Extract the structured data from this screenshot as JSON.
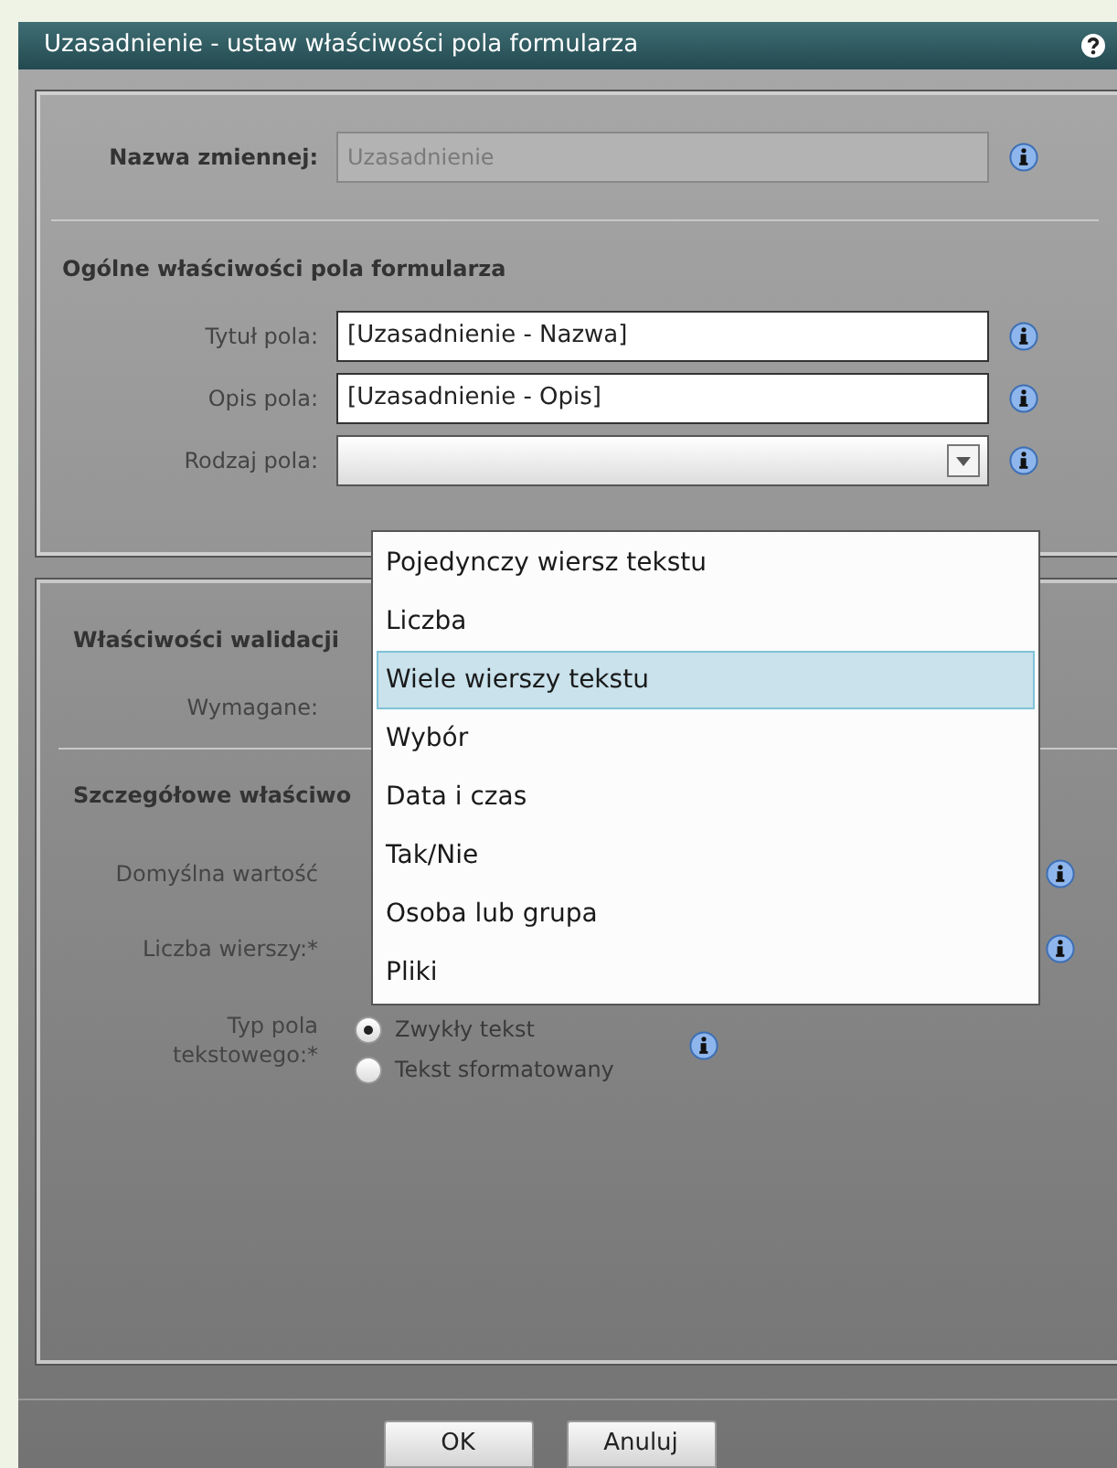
{
  "title": "Uzasadnienie - ustaw właściwości pola formularza",
  "variable": {
    "label": "Nazwa zmiennej:",
    "value": "Uzasadnienie",
    "disabled": true
  },
  "general": {
    "heading": "Ogólne właściwości pola formularza",
    "fields": [
      {
        "kind": "text",
        "label": "Tytuł pola:",
        "value": "[Uzasadnienie - Nazwa]"
      },
      {
        "kind": "text",
        "label": "Opis pola:",
        "value": "[Uzasadnienie - Opis]"
      },
      {
        "kind": "select",
        "label": "Rodzaj pola:",
        "expanded": true
      }
    ]
  },
  "dropdown": {
    "options": [
      {
        "label": "Pojedynczy wiersz tekstu",
        "selected": false
      },
      {
        "label": "Liczba",
        "selected": false
      },
      {
        "label": "Wiele wierszy tekstu",
        "selected": true
      },
      {
        "label": "Wybór",
        "selected": false
      },
      {
        "label": "Data i czas",
        "selected": false
      },
      {
        "label": "Tak/Nie",
        "selected": false
      },
      {
        "label": "Osoba lub grupa",
        "selected": false
      },
      {
        "label": "Pliki",
        "selected": false
      }
    ]
  },
  "validation": {
    "heading": "Właściwości walidacji",
    "fields": [
      {
        "label": "Wymagane:"
      }
    ]
  },
  "details": {
    "heading": "Szczegółowe właściwo",
    "fields": [
      {
        "label": "Domyślna wartość"
      },
      {
        "label": "Liczba wierszy:*"
      }
    ],
    "text_type": {
      "label": "Typ pola tekstowego:*",
      "options": [
        {
          "label": "Zwykły tekst",
          "selected": true
        },
        {
          "label": "Tekst sformatowany",
          "selected": false
        }
      ]
    }
  },
  "buttons": [
    "OK",
    "Anuluj"
  ]
}
